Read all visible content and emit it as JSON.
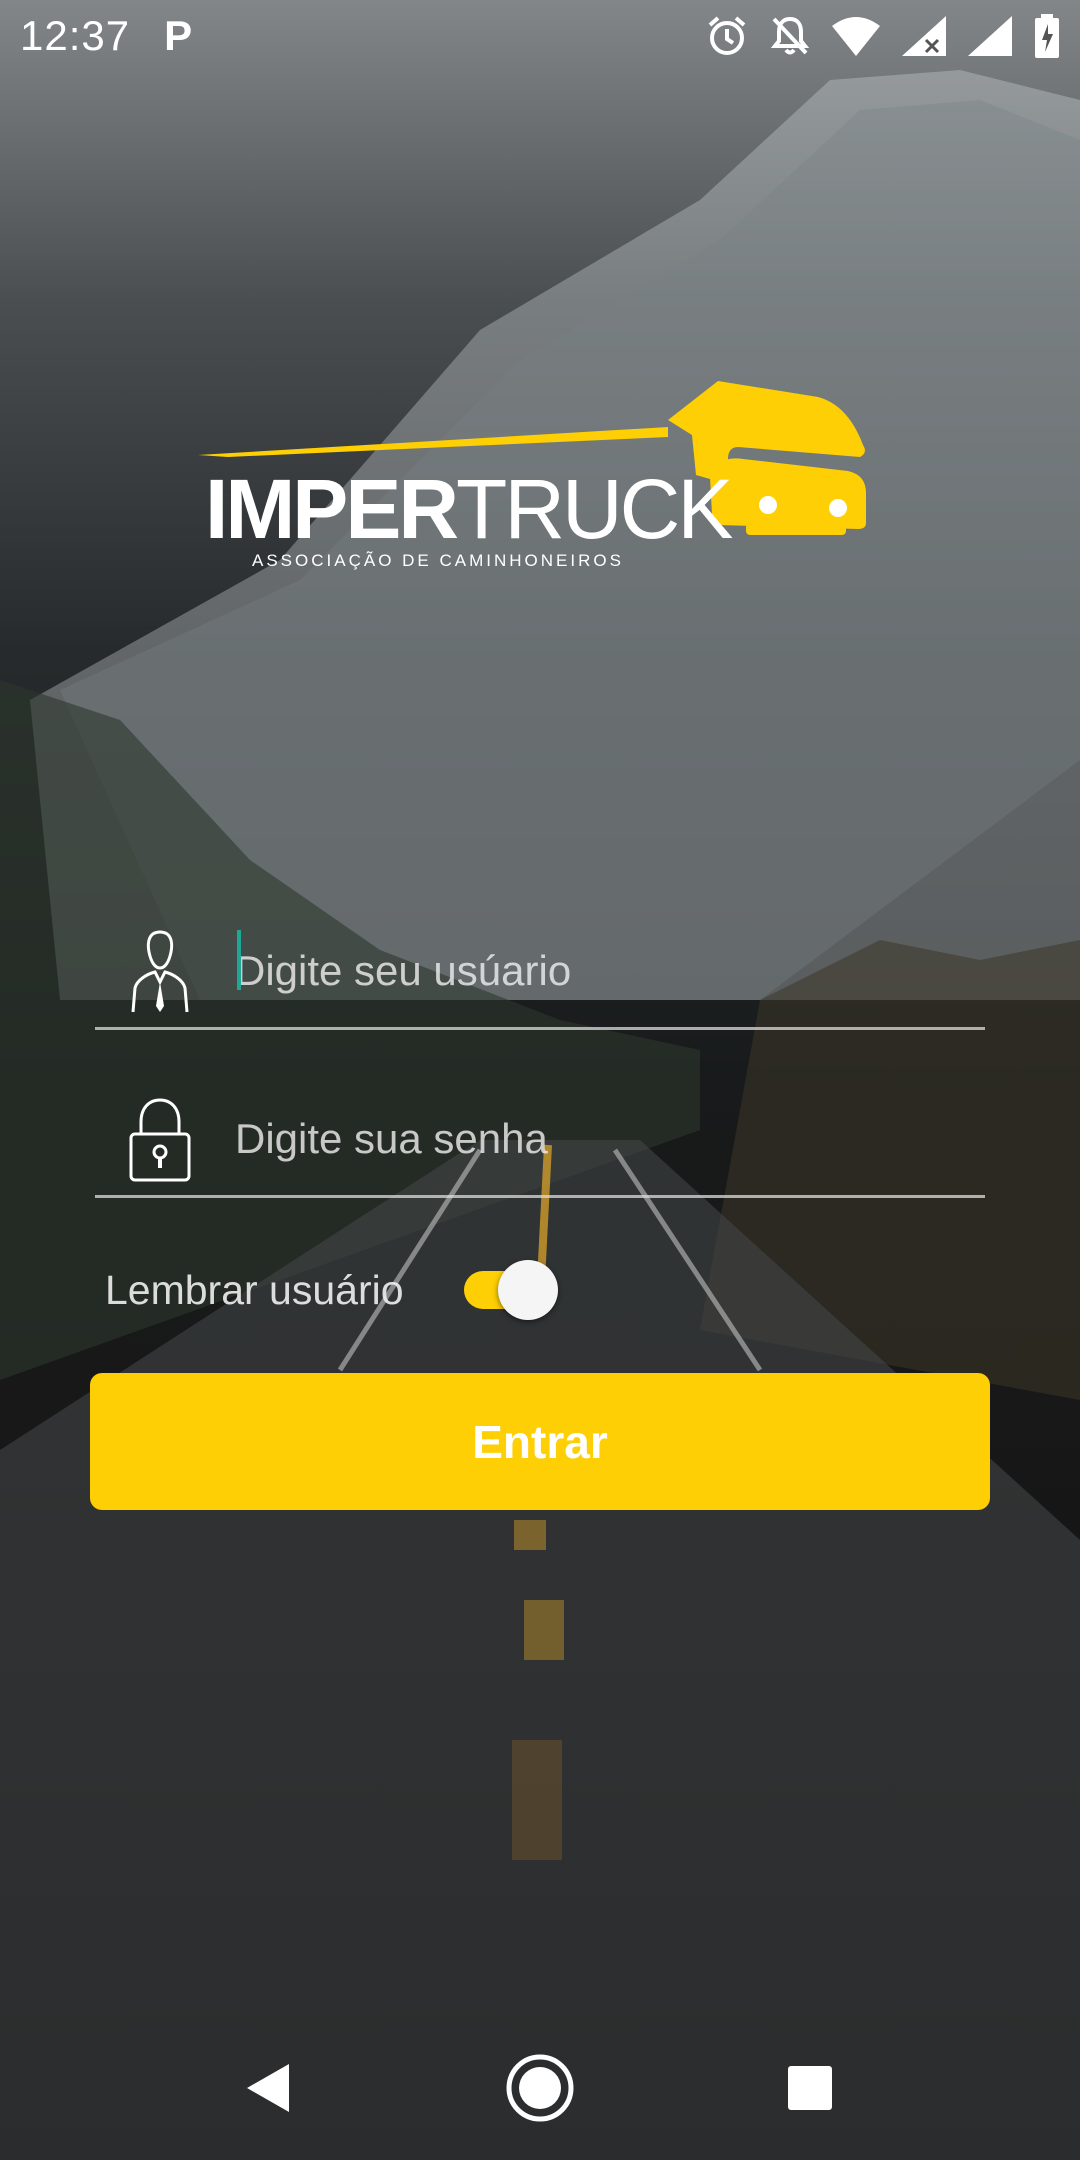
{
  "status_bar": {
    "time": "12:37",
    "notification_icon": "parking-p-icon",
    "right_icons": [
      "alarm-icon",
      "do-not-disturb-icon",
      "wifi-icon",
      "cellular-signal-icon",
      "battery-icon"
    ]
  },
  "logo": {
    "word_bold": "IMPER",
    "word_light": "TRUCK",
    "tagline": "ASSOCIAÇÃO DE CAMINHONEIROS",
    "accent_color": "#fecf04"
  },
  "login": {
    "username_placeholder": "Digite seu usúario",
    "username_value": "",
    "password_placeholder": "Digite sua senha",
    "password_value": "",
    "remember_label": "Lembrar usuário",
    "remember_enabled": true,
    "submit_label": "Entrar"
  },
  "nav_bar": {
    "buttons": [
      "back",
      "home",
      "recents"
    ]
  },
  "colors": {
    "accent": "#fecf04",
    "cursor": "#1fa89a"
  }
}
